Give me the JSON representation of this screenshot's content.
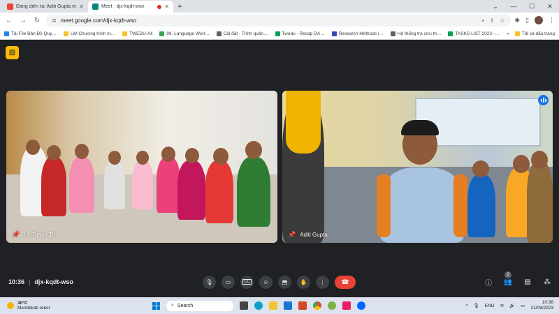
{
  "browser": {
    "tabs": [
      {
        "label": "Đang diễn ra: Aditi Gupta muốn…",
        "favicon_color": "#ea4335",
        "active": false
      },
      {
        "label": "Meet - djx-kqdt-wso",
        "favicon_color": "#00897b",
        "active": true
      }
    ],
    "url": "meet.google.com/djx-kqdt-wso",
    "bookmarks": [
      {
        "label": "Tải File Bản Đồ Quy…",
        "color": "#1e88e5"
      },
      {
        "label": "LW-Chương trình m…",
        "color": "#fbc02d"
      },
      {
        "label": "TWEDU-All",
        "color": "#fbc02d"
      },
      {
        "label": "99. Language Worl…",
        "color": "#34a853"
      },
      {
        "label": "Cài đặt - Trình quản…",
        "color": "#5f6368"
      },
      {
        "label": "Twedu - Recap DA…",
        "color": "#0f9d58"
      },
      {
        "label": "Research Methods i…",
        "color": "#3949ab"
      },
      {
        "label": "Hệ thống tra cứu th…",
        "color": "#5f6368"
      },
      {
        "label": "TASKS LIST 2023 -…",
        "color": "#0f9d58"
      }
    ],
    "bookmarks_all": "Tất cả dấu trang"
  },
  "meet": {
    "tiles": [
      {
        "name": "Lê Thanh Thu",
        "bg": "#d8d0c6"
      },
      {
        "name": "Aditi Gupta",
        "bg": "#c9b88c"
      }
    ],
    "time": "10:36",
    "meeting_code": "djx-kqdt-wso",
    "participant_count": "2",
    "end_call_color": "#ea4335",
    "accent": "#fbbc04"
  },
  "taskbar": {
    "weather_temp": "30°C",
    "weather_desc": "Mendekati rekor",
    "search_label": "Search",
    "language": "ENG",
    "time": "10:36",
    "date": "21/09/2023"
  }
}
